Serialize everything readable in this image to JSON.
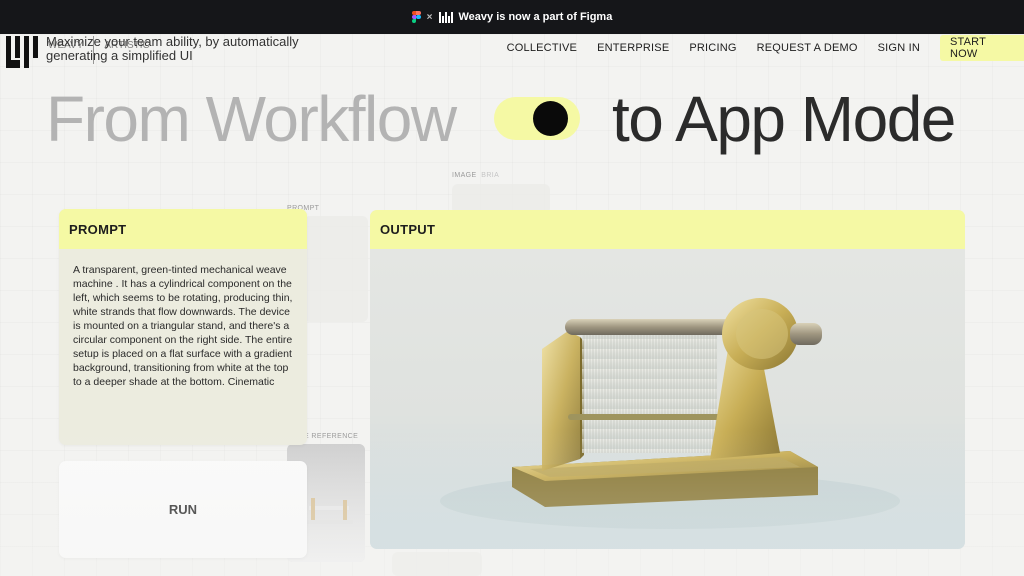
{
  "banner": {
    "text": "Weavy is now a part of Figma",
    "separator": "×"
  },
  "header": {
    "tagline": "Maximize your team ability, by automatically generating a simplified UI",
    "ghost_nav": [
      "WEAVY",
      "ARTISTIC",
      "INTELLIGENCE"
    ],
    "nav": [
      "COLLECTIVE",
      "ENTERPRISE",
      "PRICING",
      "REQUEST A DEMO",
      "SIGN IN"
    ],
    "cta": "START NOW"
  },
  "hero": {
    "left": "From Workflow",
    "right": "to App Mode"
  },
  "background_labels": {
    "prompt": "PROMPT",
    "image": "IMAGE",
    "image_sub": "BRIA",
    "reference": "E REFERENCE"
  },
  "prompt_card": {
    "title": "PROMPT",
    "text": "A transparent, green-tinted mechanical weave machine . It has a cylindrical component on the left, which seems to be rotating, producing thin, white strands that flow downwards. The device is mounted on a triangular stand, and there's a circular component on the right side. The entire setup is placed on a flat surface with a gradient background, transitioning from white at the top to a deeper shade at the bottom. Cinematic"
  },
  "run_button": {
    "label": "RUN"
  },
  "output_card": {
    "title": "OUTPUT"
  },
  "colors": {
    "accent": "#f5f9a4",
    "banner_bg": "#151619",
    "prompt_bg": "#ececdf"
  }
}
